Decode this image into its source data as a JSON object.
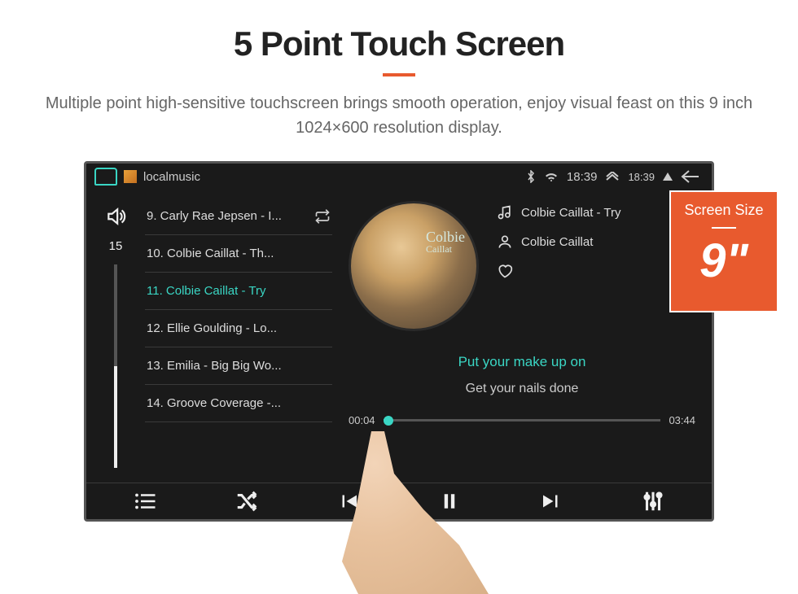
{
  "marketing": {
    "title": "5 Point Touch Screen",
    "description": "Multiple point high-sensitive touchscreen brings smooth operation, enjoy visual feast on this 9 inch 1024×600 resolution display."
  },
  "badge": {
    "title": "Screen Size",
    "value": "9\""
  },
  "status": {
    "app_label": "localmusic",
    "clock1": "18:39",
    "clock2": "18:39"
  },
  "volume": {
    "value": "15"
  },
  "playlist": [
    {
      "label": "9. Carly Rae Jepsen - I..."
    },
    {
      "label": "10. Colbie Caillat - Th..."
    },
    {
      "label": "11. Colbie Caillat - Try"
    },
    {
      "label": "12. Ellie Goulding - Lo..."
    },
    {
      "label": "13. Emilia - Big Big Wo..."
    },
    {
      "label": "14. Groove Coverage -..."
    }
  ],
  "now_playing": {
    "album_text_1": "Colbie",
    "album_text_2": "Caillat",
    "song": "Colbie Caillat - Try",
    "artist": "Colbie Caillat",
    "lyric_active": "Put your make up on",
    "lyric_next": "Get your nails done",
    "time_cur": "00:04",
    "time_total": "03:44"
  }
}
